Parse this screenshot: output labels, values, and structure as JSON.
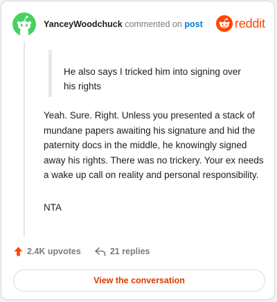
{
  "header": {
    "username": "YanceyWoodchuck",
    "commented_text": "commented on",
    "post_link": "post",
    "logo_text": "reddit"
  },
  "quote": {
    "text": "He also says I tricked him into signing over his rights"
  },
  "comment": {
    "body": "Yeah. Sure. Right. Unless you presented a stack of mundane papers awaiting his signature and hid the paternity docs in the middle, he knowingly signed away his rights. There was no trickery. Your ex needs a wake up call on reality and personal responsibility.",
    "verdict": "NTA"
  },
  "footer": {
    "upvotes": "2.4K upvotes",
    "replies": "21 replies",
    "view_button": "View the conversation"
  },
  "colors": {
    "brand": "#ff4500",
    "upvote": "#ff4500",
    "link": "#0079d3",
    "avatar_bg": "#46d160"
  },
  "icons": {
    "avatar": "snoo-avatar-icon",
    "logo": "reddit-snoo-icon",
    "upvote": "upvote-arrow-icon",
    "reply": "reply-arrow-icon"
  }
}
